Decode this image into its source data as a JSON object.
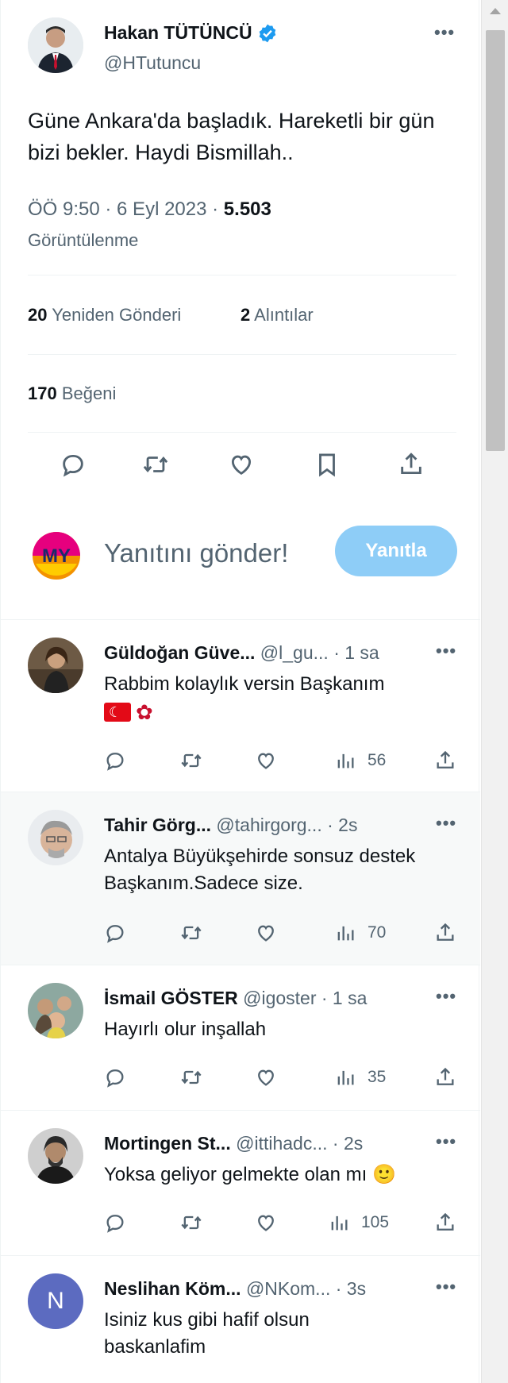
{
  "tweet": {
    "display_name": "Hakan TÜTÜNCÜ",
    "handle": "@HTutuncu",
    "text": "Güne Ankara'da başladık. Hareketli bir gün bizi bekler. Haydi Bismillah..",
    "time": "ÖÖ 9:50 · 6 Eyl 2023 · ",
    "views_count": "5.503",
    "views_label": "Görüntülenme",
    "reposts_count": "20",
    "reposts_label": "Yeniden Gönderi",
    "quotes_count": "2",
    "quotes_label": "Alıntılar",
    "likes_count": "170",
    "likes_label": "Beğeni",
    "more": "•••"
  },
  "reply_box": {
    "avatar_text": "MY",
    "placeholder": "Yanıtını gönder!",
    "button": "Yanıtla"
  },
  "replies": [
    {
      "name": "Güldoğan Güve...",
      "handle": "@l_gu... · 1 sa",
      "text": "Rabbim kolaylık versin Başkanım",
      "views": "56",
      "more": "•••"
    },
    {
      "name": "Tahir Görg...",
      "handle": "@tahirgorg... · 2s",
      "text": "Antalya Büyükşehirde sonsuz destek Başkanım.Sadece size.",
      "views": "70",
      "more": "•••"
    },
    {
      "name": "İsmail GÖSTER",
      "handle": "@igoster · 1 sa",
      "text": "Hayırlı olur inşallah",
      "views": "35",
      "more": "•••"
    },
    {
      "name": "Mortingen St...",
      "handle": "@ittihadc... · 2s",
      "text": "Yoksa geliyor gelmekte olan mı 🙂",
      "views": "105",
      "more": "•••"
    },
    {
      "name": "Neslihan Köm...",
      "handle": "@NKom... · 3s",
      "text": "Isiniz kus gibi hafif olsun baskanlafim",
      "avatar_letter": "N",
      "more": "•••"
    }
  ],
  "colors": {
    "accent": "#1d9bf0",
    "muted": "#536471",
    "reply_button": "#8ecdf7",
    "verified": "#1d9bf0"
  },
  "icons": [
    "reply-icon",
    "repost-icon",
    "like-icon",
    "bookmark-icon",
    "share-icon",
    "views-icon",
    "verified-icon",
    "more-icon"
  ]
}
